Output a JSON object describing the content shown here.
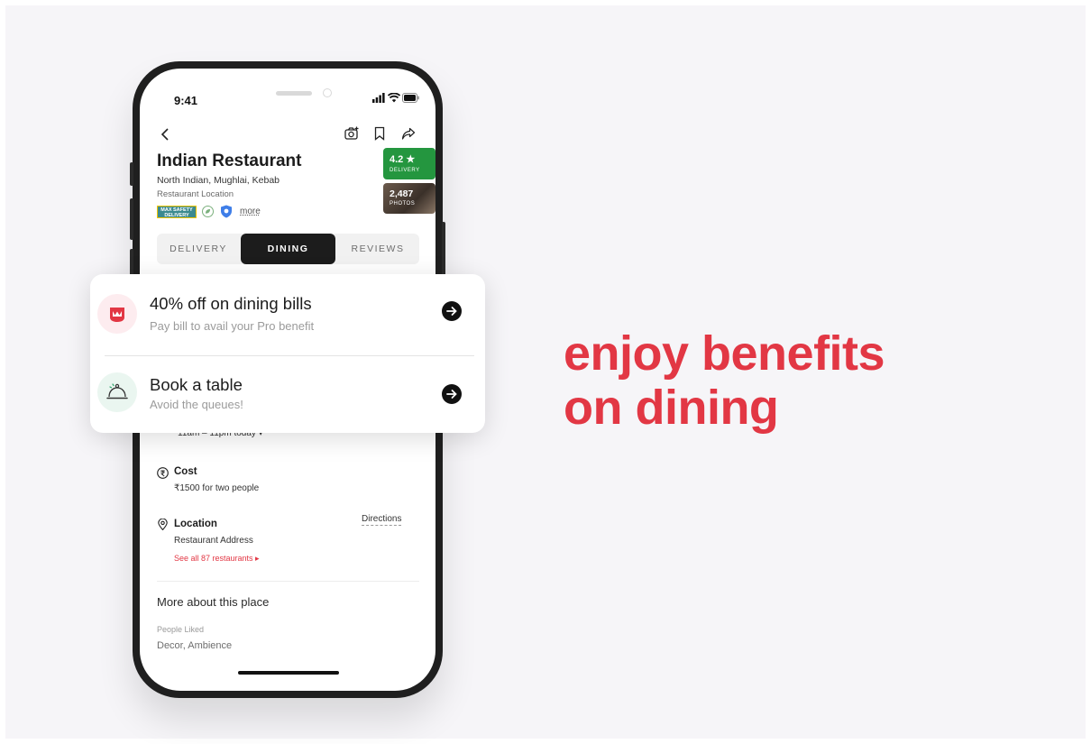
{
  "status_bar": {
    "time": "9:41"
  },
  "restaurant": {
    "name": "Indian Restaurant",
    "cuisine": "North Indian, Mughlai, Kebab",
    "location": "Restaurant Location",
    "safety_badge_line1": "MAX SAFETY",
    "safety_badge_line2": "DELIVERY",
    "more_label": "more",
    "rating": "4.2 ★",
    "rating_label": "DELIVERY",
    "photos_count": "2,487",
    "photos_label": "PHOTOS"
  },
  "tabs": [
    {
      "label": "DELIVERY",
      "active": false
    },
    {
      "label": "DINING",
      "active": true
    },
    {
      "label": "REVIEWS",
      "active": false
    }
  ],
  "details": {
    "hours_text": "11am – 11pm today ▾",
    "cost_title": "Cost",
    "cost_text": "₹1500 for two people",
    "location_title": "Location",
    "location_text": "Restaurant Address",
    "directions_label": "Directions",
    "see_all_label": "See all 87 restaurants ▸",
    "more_about_title": "More about this place",
    "people_liked_label": "People Liked",
    "people_liked_value": "Decor, Ambience"
  },
  "popup": {
    "offer_title": "40% off on dining bills",
    "offer_subtitle": "Pay bill to avail your Pro benefit",
    "book_title": "Book a table",
    "book_subtitle": "Avoid the queues!"
  },
  "headline": {
    "line1": "enjoy benefits",
    "line2": "on dining"
  },
  "colors": {
    "accent": "#e23744",
    "rating_green": "#24963f",
    "background": "#f6f5f8"
  }
}
